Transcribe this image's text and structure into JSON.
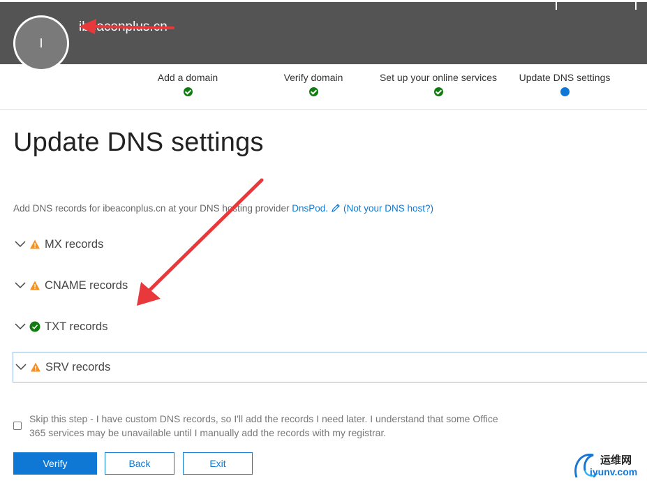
{
  "header": {
    "avatar_initial": "I",
    "domain": "ibeaconplus.cn"
  },
  "steps": [
    {
      "label": "Add a domain",
      "status": "done"
    },
    {
      "label": "Verify domain",
      "status": "done"
    },
    {
      "label": "Set up your online services",
      "status": "done"
    },
    {
      "label": "Update DNS settings",
      "status": "current"
    }
  ],
  "page": {
    "title": "Update DNS settings",
    "intro_text": "Add DNS records for ibeaconplus.cn at your DNS hosting provider",
    "provider_link": "DnsPod.",
    "not_host_link": "(Not your DNS host?)"
  },
  "records": [
    {
      "label": "MX records",
      "status": "warning"
    },
    {
      "label": "CNAME records",
      "status": "warning"
    },
    {
      "label": "TXT records",
      "status": "ok"
    },
    {
      "label": "SRV records",
      "status": "warning"
    }
  ],
  "skip": {
    "line1": "Skip this step - I have custom DNS records, so I'll add the records I need later. I understand that some Office",
    "line2": "365 services may be unavailable until I manually add the records with my registrar.",
    "checked": false
  },
  "buttons": {
    "verify": "Verify",
    "back": "Back",
    "exit": "Exit"
  },
  "watermark": {
    "cn": "运维网",
    "en": "iyunv.com"
  },
  "colors": {
    "header_bg": "#545454",
    "accent": "#0f78d4",
    "success": "#107c10",
    "warning": "#f7901e",
    "annotation_arrow": "#e8383b"
  }
}
